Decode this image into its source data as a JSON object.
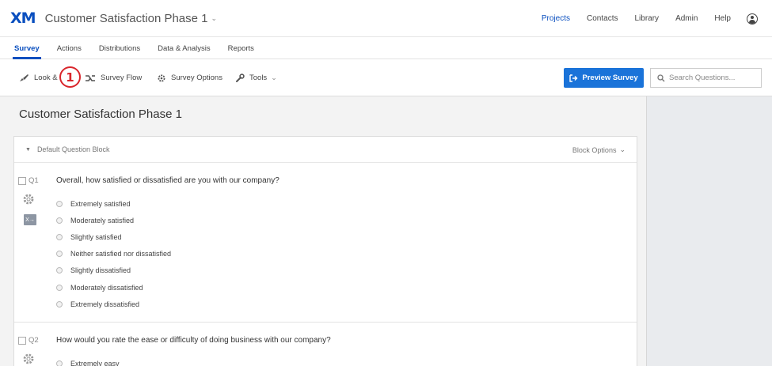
{
  "header": {
    "logo": "XM",
    "project_title": "Customer Satisfaction Phase 1",
    "nav": [
      "Projects",
      "Contacts",
      "Library",
      "Admin",
      "Help"
    ],
    "active_nav": "Projects"
  },
  "tabs": [
    "Survey",
    "Actions",
    "Distributions",
    "Data & Analysis",
    "Reports"
  ],
  "toolbar": {
    "look_feel": "Look &",
    "survey_flow": "Survey Flow",
    "survey_options": "Survey Options",
    "tools": "Tools",
    "preview_button": "Preview Survey",
    "search_placeholder": "Search Questions..."
  },
  "callout": {
    "number": "1",
    "color": "#d9262c"
  },
  "survey": {
    "title": "Customer Satisfaction Phase 1",
    "block": {
      "name": "Default Question Block",
      "options_label": "Block Options"
    },
    "questions": [
      {
        "id": "Q1",
        "text": "Overall, how satisfied or dissatisfied are you with our company?",
        "choices": [
          "Extremely satisfied",
          "Moderately satisfied",
          "Slightly satisfied",
          "Neither satisfied nor dissatisfied",
          "Slightly dissatisfied",
          "Moderately dissatisfied",
          "Extremely dissatisfied"
        ]
      },
      {
        "id": "Q2",
        "text": "How would you rate the ease or difficulty of doing business with our company?",
        "choices": [
          "Extremely easy"
        ]
      }
    ]
  },
  "colors": {
    "brand": "#0a4fbf",
    "button": "#1a73d9",
    "panel": "#e9ebee"
  }
}
